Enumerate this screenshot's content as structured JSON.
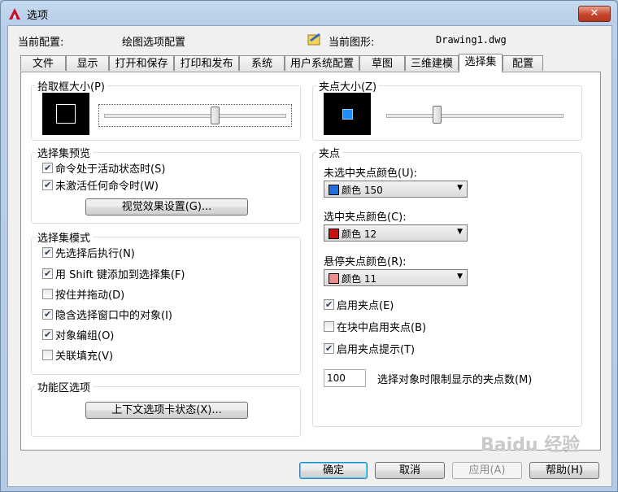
{
  "window": {
    "title": "选项",
    "close_label": "✕"
  },
  "header": {
    "current_profile_label": "当前配置:",
    "current_profile_value": "绘图选项配置",
    "current_drawing_label": "当前图形:",
    "current_drawing_value": "Drawing1.dwg"
  },
  "tabs": [
    "文件",
    "显示",
    "打开和保存",
    "打印和发布",
    "系统",
    "用户系统配置",
    "草图",
    "三维建模",
    "选择集",
    "配置"
  ],
  "active_tab": "选择集",
  "pickbox": {
    "title": "拾取框大小(P)",
    "slider_level": 0.62
  },
  "grip_size": {
    "title": "夹点大小(Z)",
    "slider_level": 0.28
  },
  "selection_preview": {
    "title": "选择集预览",
    "options": [
      {
        "label": "命令处于活动状态时(S)",
        "checked": true
      },
      {
        "label": "未激活任何命令时(W)",
        "checked": true
      }
    ],
    "visual_effects_button": "视觉效果设置(G)..."
  },
  "selection_modes": {
    "title": "选择集模式",
    "options": [
      {
        "label": "先选择后执行(N)",
        "checked": true
      },
      {
        "label": "用 Shift 键添加到选择集(F)",
        "checked": true
      },
      {
        "label": "按住并拖动(D)",
        "checked": false
      },
      {
        "label": "隐含选择窗口中的对象(I)",
        "checked": true
      },
      {
        "label": "对象编组(O)",
        "checked": true
      },
      {
        "label": "关联填充(V)",
        "checked": false
      }
    ]
  },
  "ribbon_options": {
    "title": "功能区选项",
    "context_tab_button": "上下文选项卡状态(X)..."
  },
  "grips": {
    "title": "夹点",
    "unselected_label": "未选中夹点颜色(U):",
    "unselected_value": "颜色 150",
    "unselected_color": "#1f6fe0",
    "selected_label": "选中夹点颜色(C):",
    "selected_value": "颜色 12",
    "selected_color": "#cc1111",
    "hover_label": "悬停夹点颜色(R):",
    "hover_value": "颜色 11",
    "hover_color": "#f08a8a",
    "options": [
      {
        "label": "启用夹点(E)",
        "checked": true
      },
      {
        "label": "在块中启用夹点(B)",
        "checked": false
      },
      {
        "label": "启用夹点提示(T)",
        "checked": true
      }
    ],
    "limit_value": "100",
    "limit_label": "选择对象时限制显示的夹点数(M)"
  },
  "buttons": {
    "ok": "确定",
    "cancel": "取消",
    "apply": "应用(A)",
    "help": "帮助(H)"
  },
  "watermark": "Baidu 经验"
}
